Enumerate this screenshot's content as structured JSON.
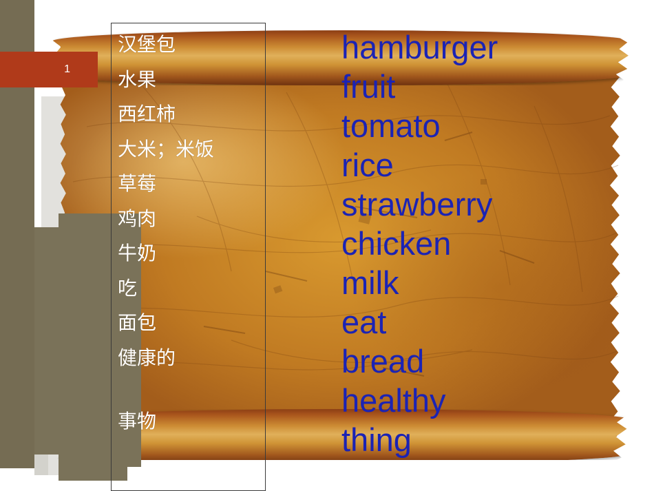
{
  "slide": {
    "number_label": "1",
    "accent_red": "#B03A1A",
    "olive": "#756C53",
    "light_gray": "#E2E1DD",
    "english_text_color": "#1B23B4",
    "chinese_text_color": "#FFFFFF"
  },
  "vocabulary": {
    "chinese": [
      "汉堡包",
      "水果",
      "西红柿",
      "大米；米饭",
      "草莓",
      "鸡肉",
      "牛奶",
      "吃",
      "面包",
      "健康的",
      "事物"
    ],
    "english": [
      "hamburger",
      "fruit",
      "tomato",
      "rice",
      "strawberry",
      "chicken",
      "milk",
      "eat",
      "bread",
      "healthy",
      "thing"
    ]
  }
}
